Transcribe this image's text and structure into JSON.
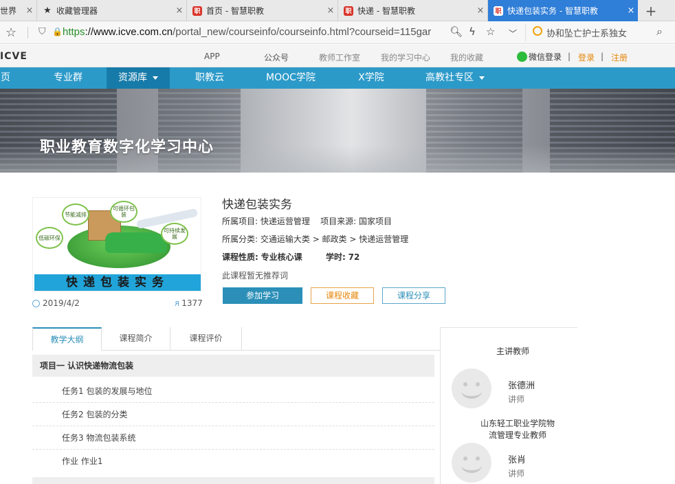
{
  "browser": {
    "tabs": [
      {
        "label": "世界",
        "icon": "globe-icon"
      },
      {
        "label": "收藏管理器",
        "icon": "star-icon"
      },
      {
        "label": "首页 - 智慧职教",
        "icon": "icve-logo-icon"
      },
      {
        "label": "快递 - 智慧职教",
        "icon": "icve-logo-icon"
      },
      {
        "label": "快递包装实务 - 智慧职教",
        "icon": "icve-logo-icon"
      }
    ],
    "close_glyph": "×",
    "new_tab_glyph": "+",
    "url_scheme": "https",
    "url_host": "://www.icve.com.cn",
    "url_path": "/portal_new/courseinfo/courseinfo.html?courseid=115gar",
    "search_text": "协和坠亡护士系独女"
  },
  "site_nav": {
    "logo": "ICVE",
    "links": [
      "APP",
      "公众号",
      "教师工作室",
      "我的学习中心",
      "我的收藏"
    ],
    "wechat_login": "微信登录",
    "sep": "|",
    "login": "登录",
    "register": "注册"
  },
  "main_nav": {
    "items": [
      {
        "label": "页",
        "dropdown": false
      },
      {
        "label": "专业群",
        "dropdown": false
      },
      {
        "label": "资源库",
        "dropdown": true
      },
      {
        "label": "职教云",
        "dropdown": false
      },
      {
        "label": "MOOC学院",
        "dropdown": false
      },
      {
        "label": "X学院",
        "dropdown": false
      },
      {
        "label": "高教社专区",
        "dropdown": true
      }
    ],
    "active_index": 2
  },
  "banner": {
    "title": "职业教育数字化学习中心"
  },
  "course": {
    "title": "快递包装实务",
    "project_label": "所属项目:",
    "project": "快递运营管理",
    "source_label": "项目来源:",
    "source": "国家项目",
    "category_label": "所属分类:",
    "category": "交通运输大类 > 邮政类 > 快递运营管理",
    "nature_label": "课程性质:",
    "nature": "专业核心课",
    "hours_label": "学时:",
    "hours": "72",
    "no_recommend": "此课程暂无推荐词",
    "date": "2019/4/2",
    "learners": "1377",
    "cover_text": "快递包装实务",
    "cover_bubbles": [
      "节能减排",
      "可循环包装",
      "低碳环保",
      "可持续发展"
    ]
  },
  "buttons": {
    "join": "参加学习",
    "favorite": "课程收藏",
    "share": "课程分享"
  },
  "content_tabs": [
    "教学大纲",
    "课程简介",
    "课程评价"
  ],
  "syllabus": {
    "unit": "项目一 认识快递物流包装",
    "tasks": [
      "任务1  包装的发展与地位",
      "任务2  包装的分类",
      "任务3  物流包装系统",
      "作业  作业1"
    ]
  },
  "teachers": {
    "heading": "主讲教师",
    "list": [
      {
        "name": "张德洲",
        "role": "讲师",
        "desc": "山东轻工职业学院物流管理专业教师"
      },
      {
        "name": "张肖",
        "role": "讲师"
      }
    ]
  }
}
